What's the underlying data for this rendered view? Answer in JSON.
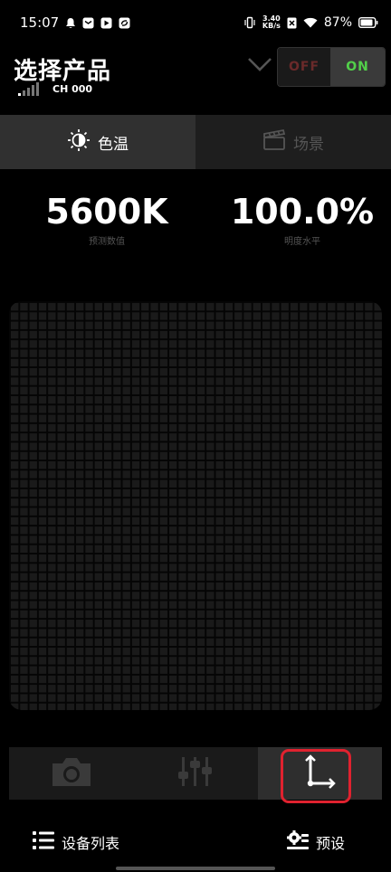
{
  "status_bar": {
    "time": "15:07",
    "network_speed_value": "3.40",
    "network_speed_unit": "KB/s",
    "battery_percent": "87%",
    "icons": [
      "notification-bell-icon",
      "mail-icon",
      "media-app-icon",
      "sync-app-icon",
      "vibrate-icon",
      "data-x-icon",
      "wifi-icon",
      "battery-icon"
    ]
  },
  "header": {
    "title": "选择产品",
    "channel": "CH 000",
    "power_off_label": "OFF",
    "power_on_label": "ON"
  },
  "tabs": [
    {
      "label": "色温",
      "icon": "brightness-icon",
      "active": true
    },
    {
      "label": "场景",
      "icon": "clapperboard-icon",
      "active": false
    }
  ],
  "readouts": {
    "cct_value": "5600K",
    "cct_label": "预测数值",
    "brightness_value": "100.0%",
    "brightness_label": "明度水平"
  },
  "toolbar": {
    "items": [
      "camera-icon",
      "sliders-icon",
      "axis-icon"
    ],
    "selected_index": 2
  },
  "bottom_bar": {
    "device_list_label": "设备列表",
    "preset_label": "预设"
  },
  "colors": {
    "on_green": "#52d04a",
    "off_red": "#6a2a2a",
    "highlight_red": "#e0222f"
  }
}
